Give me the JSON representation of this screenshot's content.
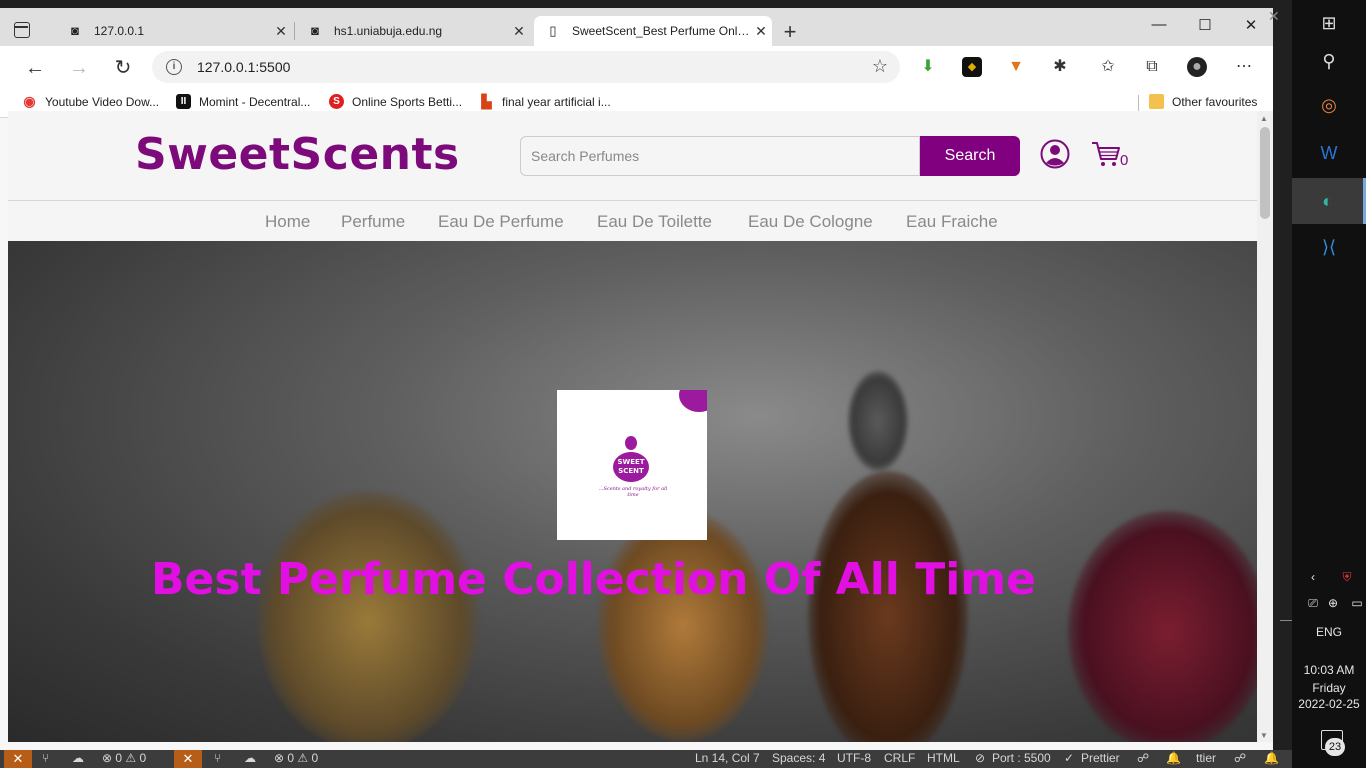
{
  "browser": {
    "tabs": [
      {
        "title": "127.0.0.1",
        "icon": "vscode-live-icon"
      },
      {
        "title": "hs1.uniabuja.edu.ng",
        "icon": "vscode-live-icon"
      },
      {
        "title": "SweetScent_Best Perfume Online",
        "icon": "page-icon",
        "active": true
      }
    ],
    "address": "127.0.0.1:5500",
    "favourites": [
      {
        "label": "Youtube Video Dow...",
        "color": "#e53935"
      },
      {
        "label": "Momint - Decentral...",
        "color": "#111111"
      },
      {
        "label": "Online Sports Betti...",
        "color": "#e02020"
      },
      {
        "label": "final year artificial i...",
        "color": "#d84315"
      }
    ],
    "other_favourites": "Other favourites"
  },
  "site": {
    "logo": "SweetScents",
    "search_placeholder": "Search Perfumes",
    "search_button": "Search",
    "cart_count": "0",
    "nav": [
      "Home",
      "Perfume",
      "Eau De Perfume",
      "Eau De Toilette",
      "Eau De Cologne",
      "Eau Fraiche"
    ],
    "hero_logo_badge": "SWEET SCENT",
    "hero_logo_tagline": "...Scents and royalty for all time",
    "hero_title": "Best Perfume Collection Of All Time",
    "accent_color": "#800080",
    "title_color": "#e10fe1"
  },
  "statusbar": {
    "problems_a": "⊗ 0 ⚠ 0",
    "problems_b": "⊗ 0 ⚠ 0",
    "cursor": "Ln 14, Col 7",
    "spaces": "Spaces: 4",
    "encoding": "UTF-8",
    "eol": "CRLF",
    "language": "HTML",
    "port": "Port : 5500",
    "prettier": "Prettier",
    "prettier_b": "ttier"
  },
  "taskbar": {
    "language": "ENG",
    "time": "10:03 AM",
    "day": "Friday",
    "date": "2022-02-25",
    "notifications": "23"
  }
}
